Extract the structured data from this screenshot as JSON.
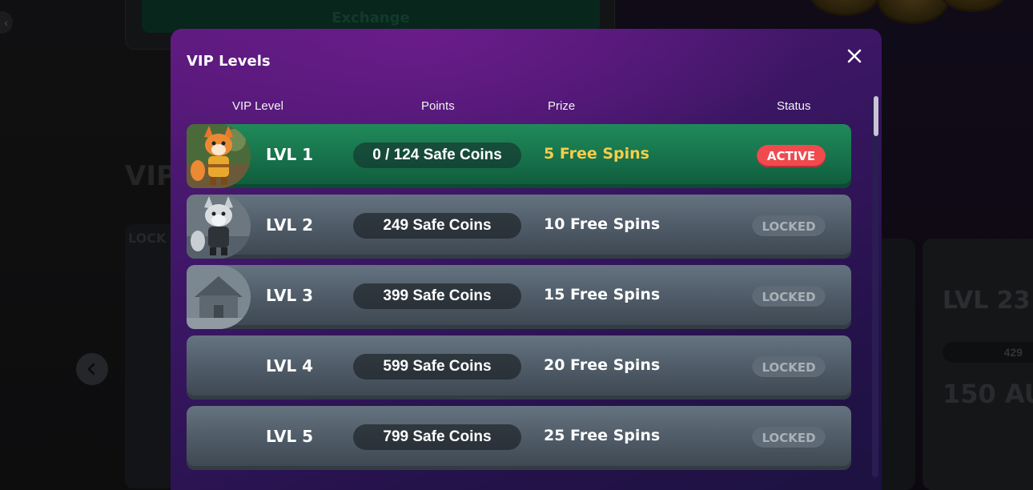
{
  "background": {
    "exchange_label": "Exchange",
    "vip_heading": "VIP",
    "left_card_label": "LOCK",
    "right_card": {
      "level": "LVL 23",
      "points": "429",
      "prize": "150 AU"
    },
    "back_icon": "chevron-left-icon",
    "prev_icon": "chevron-left-icon"
  },
  "modal": {
    "title": "VIP Levels",
    "close_icon": "close-icon",
    "columns": {
      "vip_level": "VIP Level",
      "points": "Points",
      "prize": "Prize",
      "status": "Status"
    },
    "rows": [
      {
        "level": "LVL 1",
        "points": "0 / 124 Safe Coins",
        "prize": "5 Free Spins",
        "status": "ACTIVE"
      },
      {
        "level": "LVL 2",
        "points": "249 Safe Coins",
        "prize": "10 Free Spins",
        "status": "LOCKED"
      },
      {
        "level": "LVL 3",
        "points": "399 Safe Coins",
        "prize": "15 Free Spins",
        "status": "LOCKED"
      },
      {
        "level": "LVL 4",
        "points": "599 Safe Coins",
        "prize": "20 Free Spins",
        "status": "LOCKED"
      },
      {
        "level": "LVL 5",
        "points": "799 Safe Coins",
        "prize": "25 Free Spins",
        "status": "LOCKED"
      }
    ]
  },
  "colors": {
    "active_row": "#1f8a5a",
    "locked_row": "#4d5965",
    "active_badge": "#f04a4f",
    "prize_active": "#f6cd4b",
    "modal_top": "#5a1a7c",
    "modal_bottom": "#1c1240"
  }
}
